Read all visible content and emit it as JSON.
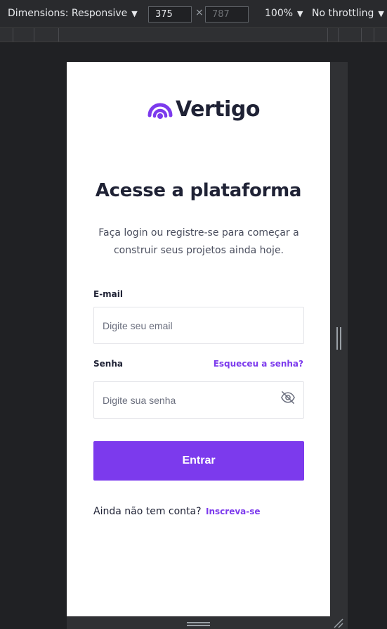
{
  "devtools": {
    "dimensions_label": "Dimensions: Responsive",
    "width_value": "375",
    "height_placeholder": "787",
    "times": "×",
    "zoom": "100%",
    "throttling": "No throttling"
  },
  "page": {
    "brand": "Vertigo",
    "title": "Acesse a plataforma",
    "subtitle": "Faça login ou registre-se para começar a construir seus projetos ainda hoje.",
    "email_label": "E-mail",
    "email_placeholder": "Digite seu email",
    "password_label": "Senha",
    "forgot_link": "Esqueceu a senha?",
    "password_placeholder": "Digite sua senha",
    "submit_label": "Entrar",
    "signup_prompt": "Ainda não tem conta?",
    "signup_link": "Inscreva-se"
  },
  "colors": {
    "accent": "#7c3aed",
    "text_dark": "#1f2235",
    "devtools_bg": "#292a2d"
  },
  "icons": {
    "brand_logo": "vertigo-logo-icon",
    "password_toggle": "eye-off-icon"
  }
}
